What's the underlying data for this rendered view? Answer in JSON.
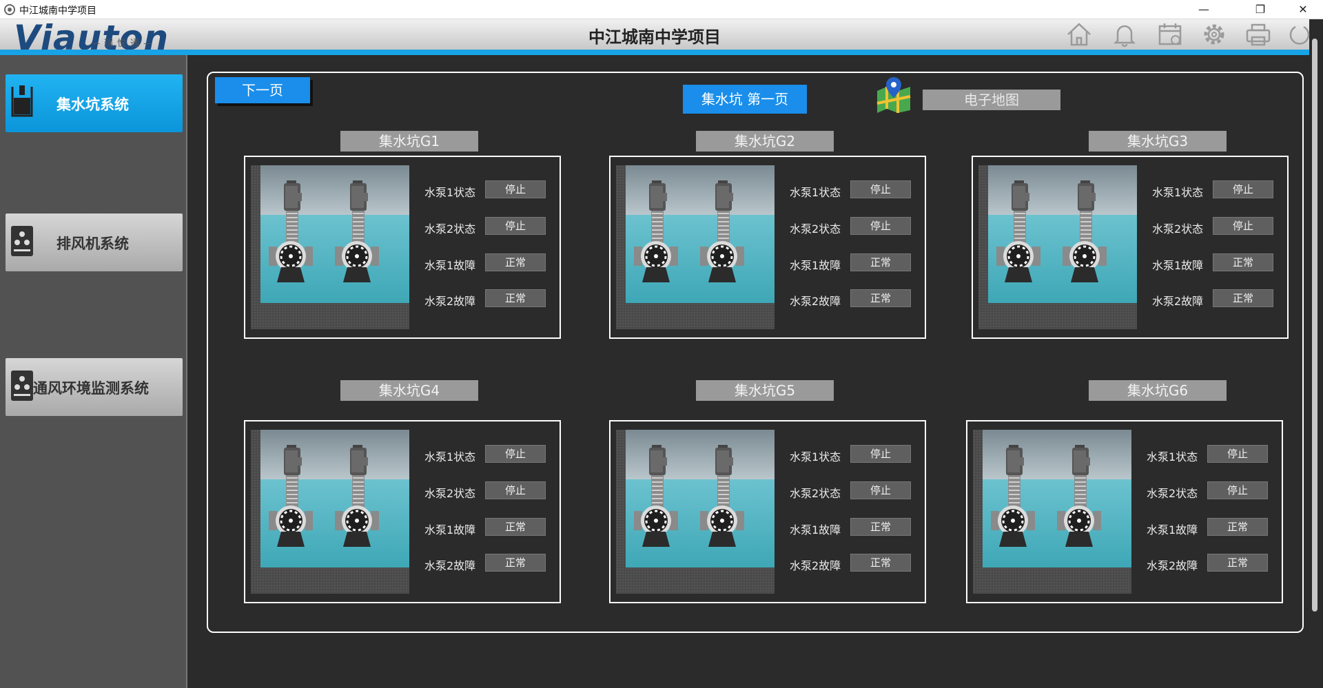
{
  "window": {
    "title": "中江城南中学项目",
    "min": "—",
    "max": "❐",
    "close": "✕"
  },
  "header": {
    "logo": "Viauton",
    "logo_sub": "—瑞悦通—",
    "title": "中江城南中学项目"
  },
  "header_icons": [
    "home-icon",
    "bell-icon",
    "calendar-icon",
    "gear-icon",
    "printer-icon",
    "power-icon"
  ],
  "sidebar": {
    "items": [
      {
        "label": "集水坑系统",
        "icon": "sump-icon",
        "active": true
      },
      {
        "label": "排风机系统",
        "icon": "fan-icon",
        "active": false
      },
      {
        "label": "通风环境监测系统",
        "icon": "fan-icon",
        "active": false
      }
    ]
  },
  "main": {
    "next_page": "下一页",
    "page_indicator": "集水坑 第一页",
    "map_label": "电子地图"
  },
  "pits": [
    {
      "name": "集水坑G1",
      "statuses": [
        {
          "label": "水泵1状态",
          "value": "停止"
        },
        {
          "label": "水泵2状态",
          "value": "停止"
        },
        {
          "label": "水泵1故障",
          "value": "正常"
        },
        {
          "label": "水泵2故障",
          "value": "正常"
        }
      ]
    },
    {
      "name": "集水坑G2",
      "statuses": [
        {
          "label": "水泵1状态",
          "value": "停止"
        },
        {
          "label": "水泵2状态",
          "value": "停止"
        },
        {
          "label": "水泵1故障",
          "value": "正常"
        },
        {
          "label": "水泵2故障",
          "value": "正常"
        }
      ]
    },
    {
      "name": "集水坑G3",
      "statuses": [
        {
          "label": "水泵1状态",
          "value": "停止"
        },
        {
          "label": "水泵2状态",
          "value": "停止"
        },
        {
          "label": "水泵1故障",
          "value": "正常"
        },
        {
          "label": "水泵2故障",
          "value": "正常"
        }
      ]
    },
    {
      "name": "集水坑G4",
      "statuses": [
        {
          "label": "水泵1状态",
          "value": "停止"
        },
        {
          "label": "水泵2状态",
          "value": "停止"
        },
        {
          "label": "水泵1故障",
          "value": "正常"
        },
        {
          "label": "水泵2故障",
          "value": "正常"
        }
      ]
    },
    {
      "name": "集水坑G5",
      "statuses": [
        {
          "label": "水泵1状态",
          "value": "停止"
        },
        {
          "label": "水泵2状态",
          "value": "停止"
        },
        {
          "label": "水泵1故障",
          "value": "正常"
        },
        {
          "label": "水泵2故障",
          "value": "正常"
        }
      ]
    },
    {
      "name": "集水坑G6",
      "statuses": [
        {
          "label": "水泵1状态",
          "value": "停止"
        },
        {
          "label": "水泵2状态",
          "value": "停止"
        },
        {
          "label": "水泵1故障",
          "value": "正常"
        },
        {
          "label": "水泵2故障",
          "value": "正常"
        }
      ]
    }
  ],
  "colors": {
    "accent": "#1a8eea",
    "header_line": "#17a3e6",
    "background": "#2b2b2b",
    "sidebar": "#525252"
  }
}
